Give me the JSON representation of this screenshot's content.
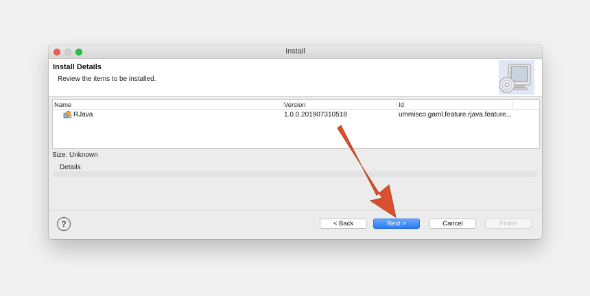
{
  "window": {
    "title": "Install"
  },
  "header": {
    "title": "Install Details",
    "description": "Review the items to be installed.",
    "icon": "computer-cd-icon"
  },
  "table": {
    "columns": [
      "Name",
      "Version",
      "Id"
    ],
    "rows": [
      {
        "icon": "feature-plugin-icon",
        "name": "RJava",
        "version": "1.0.0.201907310518",
        "id": "ummisco.gaml.feature.rjava.feature..."
      }
    ]
  },
  "size_label": "Size: Unknown",
  "details_label": "Details",
  "help_icon": "help-icon",
  "buttons": {
    "back": "< Back",
    "next": "Next >",
    "cancel": "Cancel",
    "finish": "Finish"
  },
  "colors": {
    "accent": "#2c7cf5",
    "annotation_arrow": "#d9502f"
  }
}
